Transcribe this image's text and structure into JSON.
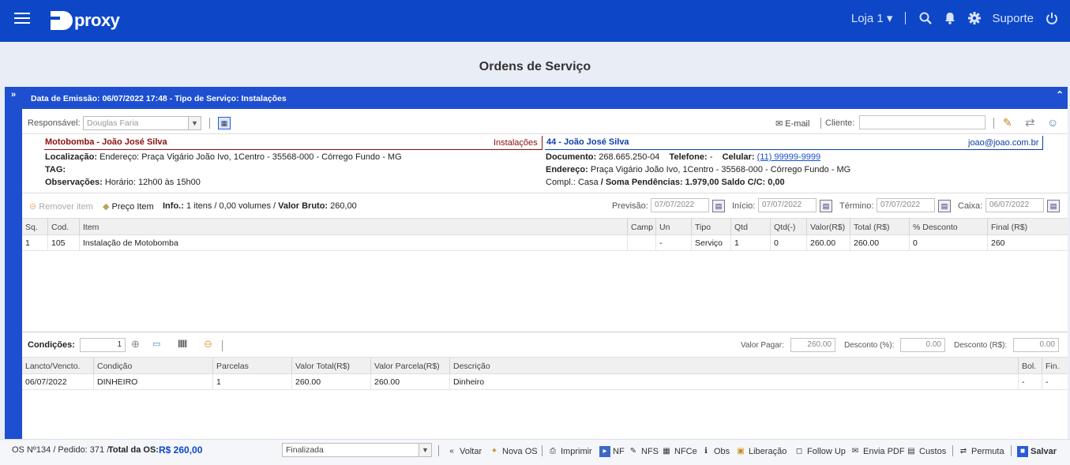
{
  "app": {
    "logo": "proxy"
  },
  "topbar": {
    "store": "Loja 1",
    "support": "Suporte",
    "icons": [
      "menu-icon",
      "search-icon",
      "bell-icon",
      "gear-icon",
      "power-icon"
    ]
  },
  "page": {
    "title": "Ordens de Serviço"
  },
  "panel": {
    "header": "Data de Emissão: 06/07/2022 17:48 - Tipo de Serviço: Instalações",
    "responsavel_label": "Responsável:",
    "responsavel_value": "Douglas Faria",
    "email_label": "E-mail",
    "cliente_label": "Cliente:",
    "cliente_value": ""
  },
  "service": {
    "title": "Motobomba - João José Silva",
    "type": "Instalações",
    "loc_label": "Localização:",
    "loc_value": "Endereço: Praça Vigário João Ivo, 1Centro - 35568-000 - Córrego Fundo - MG",
    "tag_label": "TAG:",
    "obs_label": "Observações:",
    "obs_value": "Horário: 12h00 às 15h00"
  },
  "client": {
    "title": "44 - João José Silva",
    "email": "joao@joao.com.br",
    "doc_label": "Documento:",
    "doc_value": "268.665.250-04",
    "tel_label": "Telefone:",
    "tel_value": "-",
    "cel_label": "Celular:",
    "cel_value": "(11) 99999-9999",
    "end_label": "Endereço:",
    "end_value": "Praça Vigário João Ivo, 1Centro - 35568-000 - Córrego Fundo - MG",
    "compl_label": "Compl.: Casa",
    "soma_label": "/ Soma Pendências: 1.979,00 Saldo C/C: 0,00"
  },
  "items_bar": {
    "remove": "Remover item",
    "price": "Preço Item",
    "info_label": "Info.:",
    "info_value": "1 itens / 0,00 volumes /",
    "bruto_label": "Valor Bruto:",
    "bruto_value": "260,00",
    "previsao_label": "Previsão:",
    "previsao": "07/07/2022",
    "inicio_label": "Início:",
    "inicio": "07/07/2022",
    "termino_label": "Término:",
    "termino": "07/07/2022",
    "caixa_label": "Caixa:",
    "caixa": "06/07/2022"
  },
  "items_table": {
    "headers": [
      "Sq.",
      "Cod.",
      "Item",
      "Camp",
      "Un",
      "Tipo",
      "Qtd",
      "Qtd(-)",
      "Valor(R$)",
      "Total (R$)",
      "% Desconto",
      "Final (R$)"
    ],
    "rows": [
      [
        "1",
        "105",
        "Instalação de Motobomba",
        "",
        "-",
        "Serviço",
        "1",
        "0",
        "260.00",
        "260.00",
        "0",
        "260"
      ]
    ]
  },
  "conditions": {
    "label": "Condições:",
    "value": "1",
    "valor_pagar_label": "Valor Pagar:",
    "valor_pagar": "260.00",
    "desc_pct_label": "Desconto (%):",
    "desc_pct": "0.00",
    "desc_rs_label": "Desconto (R$):",
    "desc_rs": "0.00"
  },
  "payments_table": {
    "headers": [
      "Lancto/Vencto.",
      "Condição",
      "Parcelas",
      "Valor Total(R$)",
      "Valor Parcela(R$)",
      "Descrição",
      "Bol.",
      "Fin."
    ],
    "rows": [
      [
        "06/07/2022",
        "DINHEIRO",
        "1",
        "260.00",
        "260.00",
        "Dinheiro",
        "-",
        "-"
      ]
    ]
  },
  "footer": {
    "os_info": "OS Nº134 / Pedido: 371 /",
    "total_label": "Total da OS:",
    "total_value": "R$ 260,00",
    "status": "Finalizada",
    "buttons": [
      "Voltar",
      "Nova OS",
      "Imprimir",
      "NF",
      "NFS",
      "NFCe",
      "Obs",
      "Liberação",
      "Follow Up",
      "Envia PDF",
      "Custos",
      "Permuta",
      "Salvar"
    ]
  }
}
